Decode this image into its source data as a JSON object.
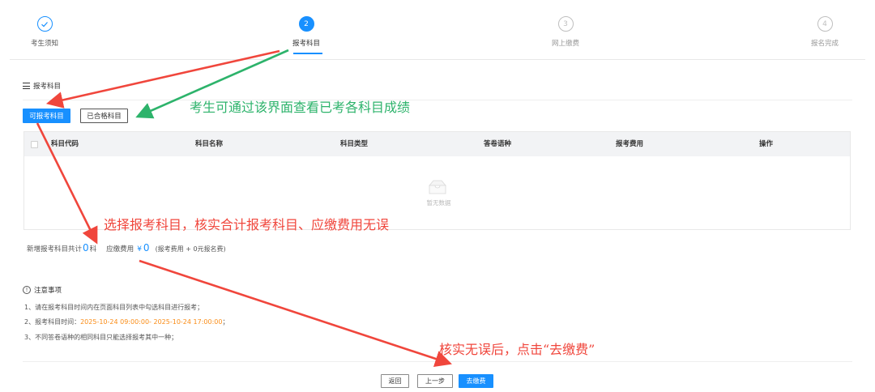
{
  "steps": [
    {
      "number": "",
      "label": "考生须知",
      "state": "done"
    },
    {
      "number": "2",
      "label": "报考科目",
      "state": "active"
    },
    {
      "number": "3",
      "label": "网上缴费",
      "state": "todo"
    },
    {
      "number": "4",
      "label": "报名完成",
      "state": "todo"
    }
  ],
  "section": {
    "title": "报考科目"
  },
  "tabs": {
    "available": "可报考科目",
    "passed": "已合格科目"
  },
  "table": {
    "columns": [
      "科目代码",
      "科目名称",
      "科目类型",
      "答卷语种",
      "报考费用",
      "操作"
    ],
    "empty_text": "暂无数据"
  },
  "summary": {
    "count_prefix": "新增报考科目共计",
    "count": "0",
    "count_suffix": "科",
    "fee_prefix": "应缴费用",
    "currency": "¥",
    "fee": "0",
    "fee_note": "(报考费用 + 0元报名费)"
  },
  "notes": {
    "title": "注意事项",
    "item1": "1、请在报考科目时间内在页面科目列表中勾选科目进行报考；",
    "item2_prefix": "2、报考科目时间：",
    "item2_time": "2025-10-24 09:00:00- 2025-10-24 17:00:00",
    "item2_suffix": "；",
    "item3": "3、不同答卷语种的相同科目只能选择报考其中一种；"
  },
  "buttons": {
    "back": "返回",
    "prev": "上一步",
    "pay": "去缴费"
  },
  "annotations": {
    "green": "考生可通过该界面查看已考各科目成绩",
    "red1": "选择报考科目，核实合计报考科目、应缴费用无误",
    "red2": "核实无误后，点击“去缴费”"
  },
  "colors": {
    "primary": "#1890ff",
    "annotation_red": "#f0463c",
    "annotation_green": "#2db36b",
    "time_orange": "#fa8c16"
  }
}
